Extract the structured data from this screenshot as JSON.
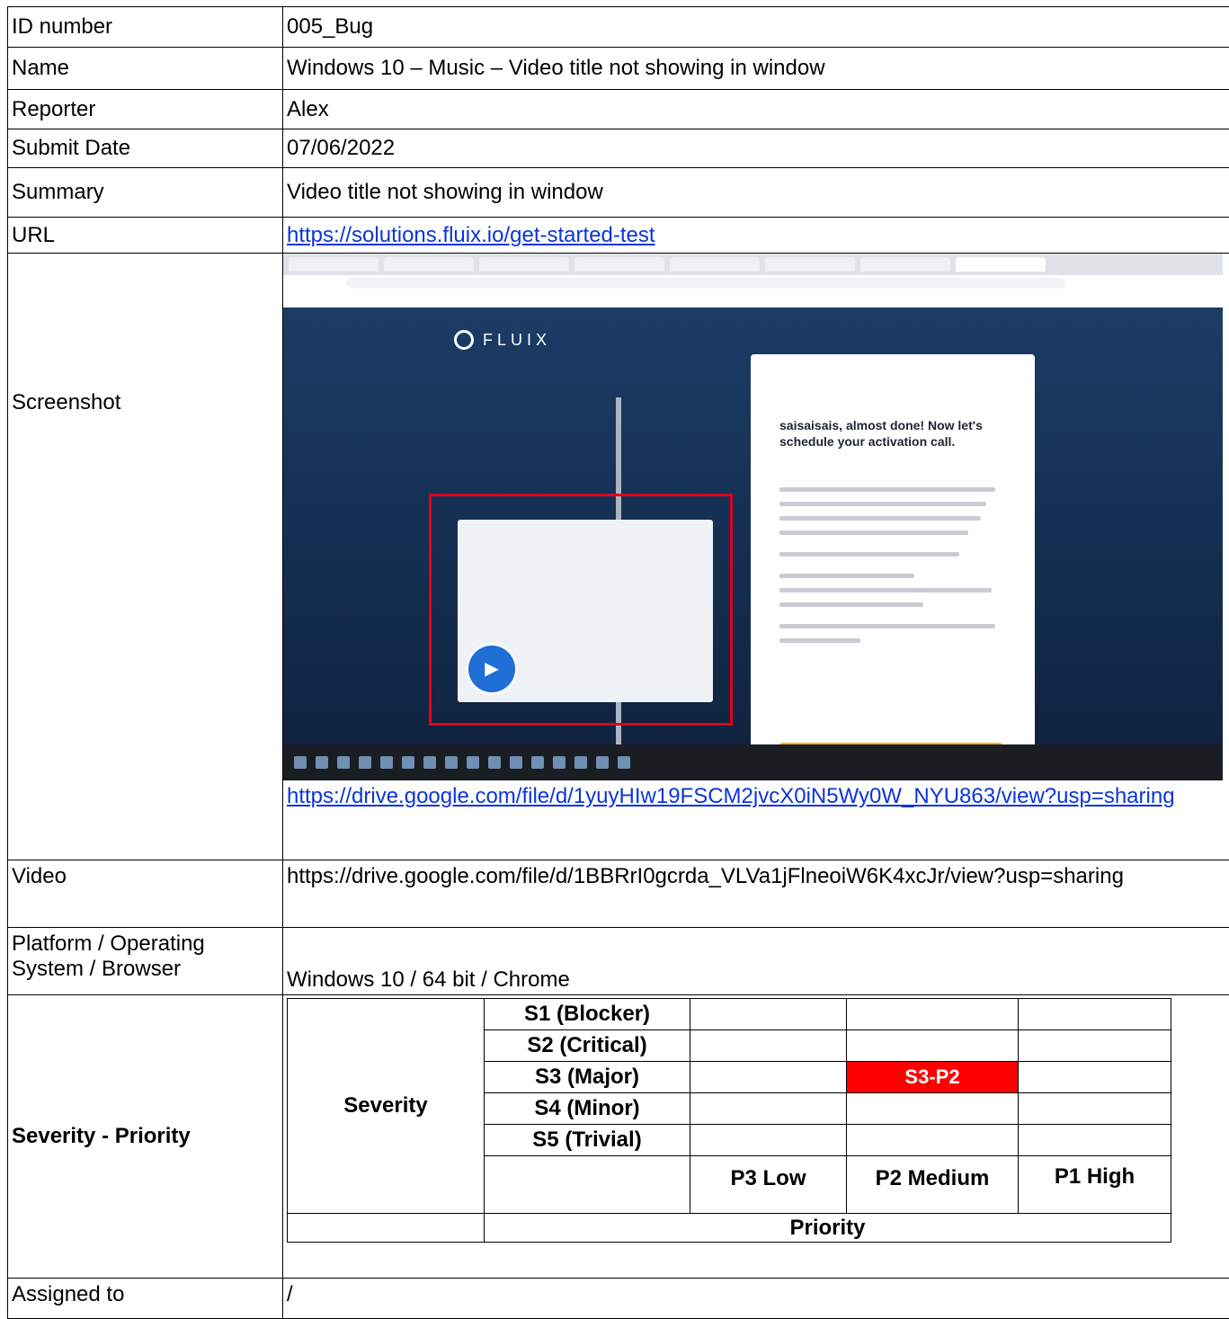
{
  "rows": {
    "id": {
      "label": "ID number",
      "value": "005_Bug"
    },
    "name": {
      "label": "Name",
      "value": "Windows 10 – Music – Video title not showing in window"
    },
    "reporter": {
      "label": "Reporter",
      "value": "Alex"
    },
    "submit_date": {
      "label": "Submit Date",
      "value": "07/06/2022"
    },
    "summary": {
      "label": "Summary",
      "value": "Video title not showing in window"
    },
    "url": {
      "label": "URL",
      "value": "https://solutions.fluix.io/get-started-test"
    },
    "screenshot": {
      "label": "Screenshot",
      "link": "https://drive.google.com/file/d/1yuyHIw19FSCM2jvcX0iN5Wy0W_NYU863/view?usp=sharing",
      "image": {
        "logo_text": "FLUIX",
        "card_heading": "saisaisais, almost done! Now let's schedule your activation call.",
        "accent_color": "#f6b90b",
        "highlight_color": "#e2001a"
      }
    },
    "video": {
      "label": "Video",
      "value": "https://drive.google.com/file/d/1BBRrI0gcrda_VLVa1jFlneoiW6K4xcJr/view?usp=sharing"
    },
    "platform": {
      "label": "Platform / Operating System / Browser",
      "value": "Windows 10 / 64 bit / Chrome"
    },
    "severity_priority": {
      "label": "Severity - Priority",
      "severity_title": "Severity",
      "priority_title": "Priority",
      "severities": [
        "S1 (Blocker)",
        "S2 (Critical)",
        "S3 (Major)",
        "S4 (Minor)",
        "S5 (Trivial)"
      ],
      "priorities": [
        "P3 Low",
        "P2 Medium",
        "P1 High"
      ],
      "selected": "S3-P2",
      "selected_color": "#ff0000"
    },
    "assigned": {
      "label": "Assigned to",
      "value": "/"
    }
  }
}
